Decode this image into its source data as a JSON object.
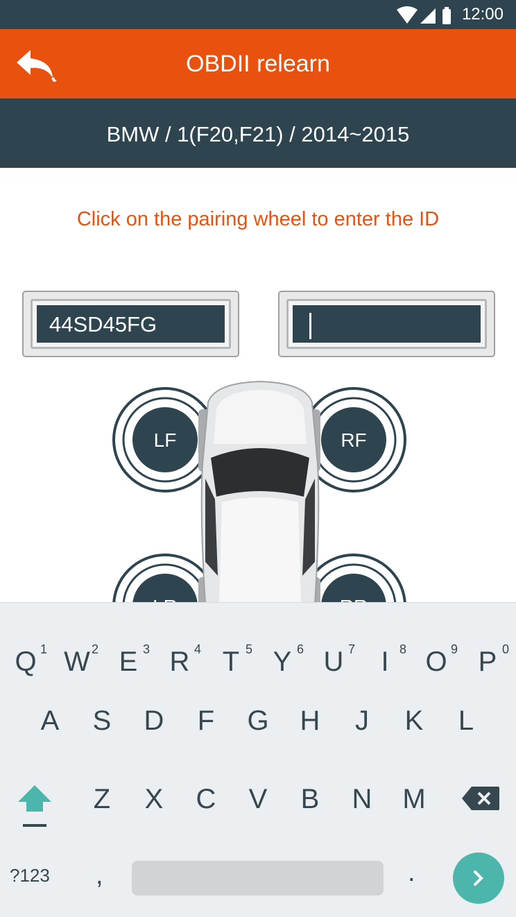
{
  "status_bar": {
    "time": "12:00",
    "icons": [
      "wifi-icon",
      "signal-icon",
      "battery-icon"
    ]
  },
  "app_bar": {
    "title": "OBDII relearn",
    "back_icon": "back-arrow-icon",
    "color": "#e9510e"
  },
  "vehicle": {
    "path": "BMW / 1(F20,F21) / 2014~2015"
  },
  "instruction": "Click on the pairing wheel to enter the ID",
  "id_fields": [
    {
      "value": "44SD45FG"
    },
    {
      "value": ""
    }
  ],
  "wheels": {
    "lf": "LF",
    "rf": "RF",
    "lr": "LR",
    "rr": "RR"
  },
  "keyboard": {
    "row1": [
      {
        "key": "Q",
        "hint": "1"
      },
      {
        "key": "W",
        "hint": "2"
      },
      {
        "key": "E",
        "hint": "3"
      },
      {
        "key": "R",
        "hint": "4"
      },
      {
        "key": "T",
        "hint": "5"
      },
      {
        "key": "Y",
        "hint": "6"
      },
      {
        "key": "U",
        "hint": "7"
      },
      {
        "key": "I",
        "hint": "8"
      },
      {
        "key": "O",
        "hint": "9"
      },
      {
        "key": "P",
        "hint": "0"
      }
    ],
    "row2": [
      "A",
      "S",
      "D",
      "F",
      "G",
      "H",
      "J",
      "K",
      "L"
    ],
    "row3": [
      "Z",
      "X",
      "C",
      "V",
      "B",
      "N",
      "M"
    ],
    "symbols": "?123",
    "comma": ",",
    "period": ".",
    "accent": "#4db6ac"
  }
}
